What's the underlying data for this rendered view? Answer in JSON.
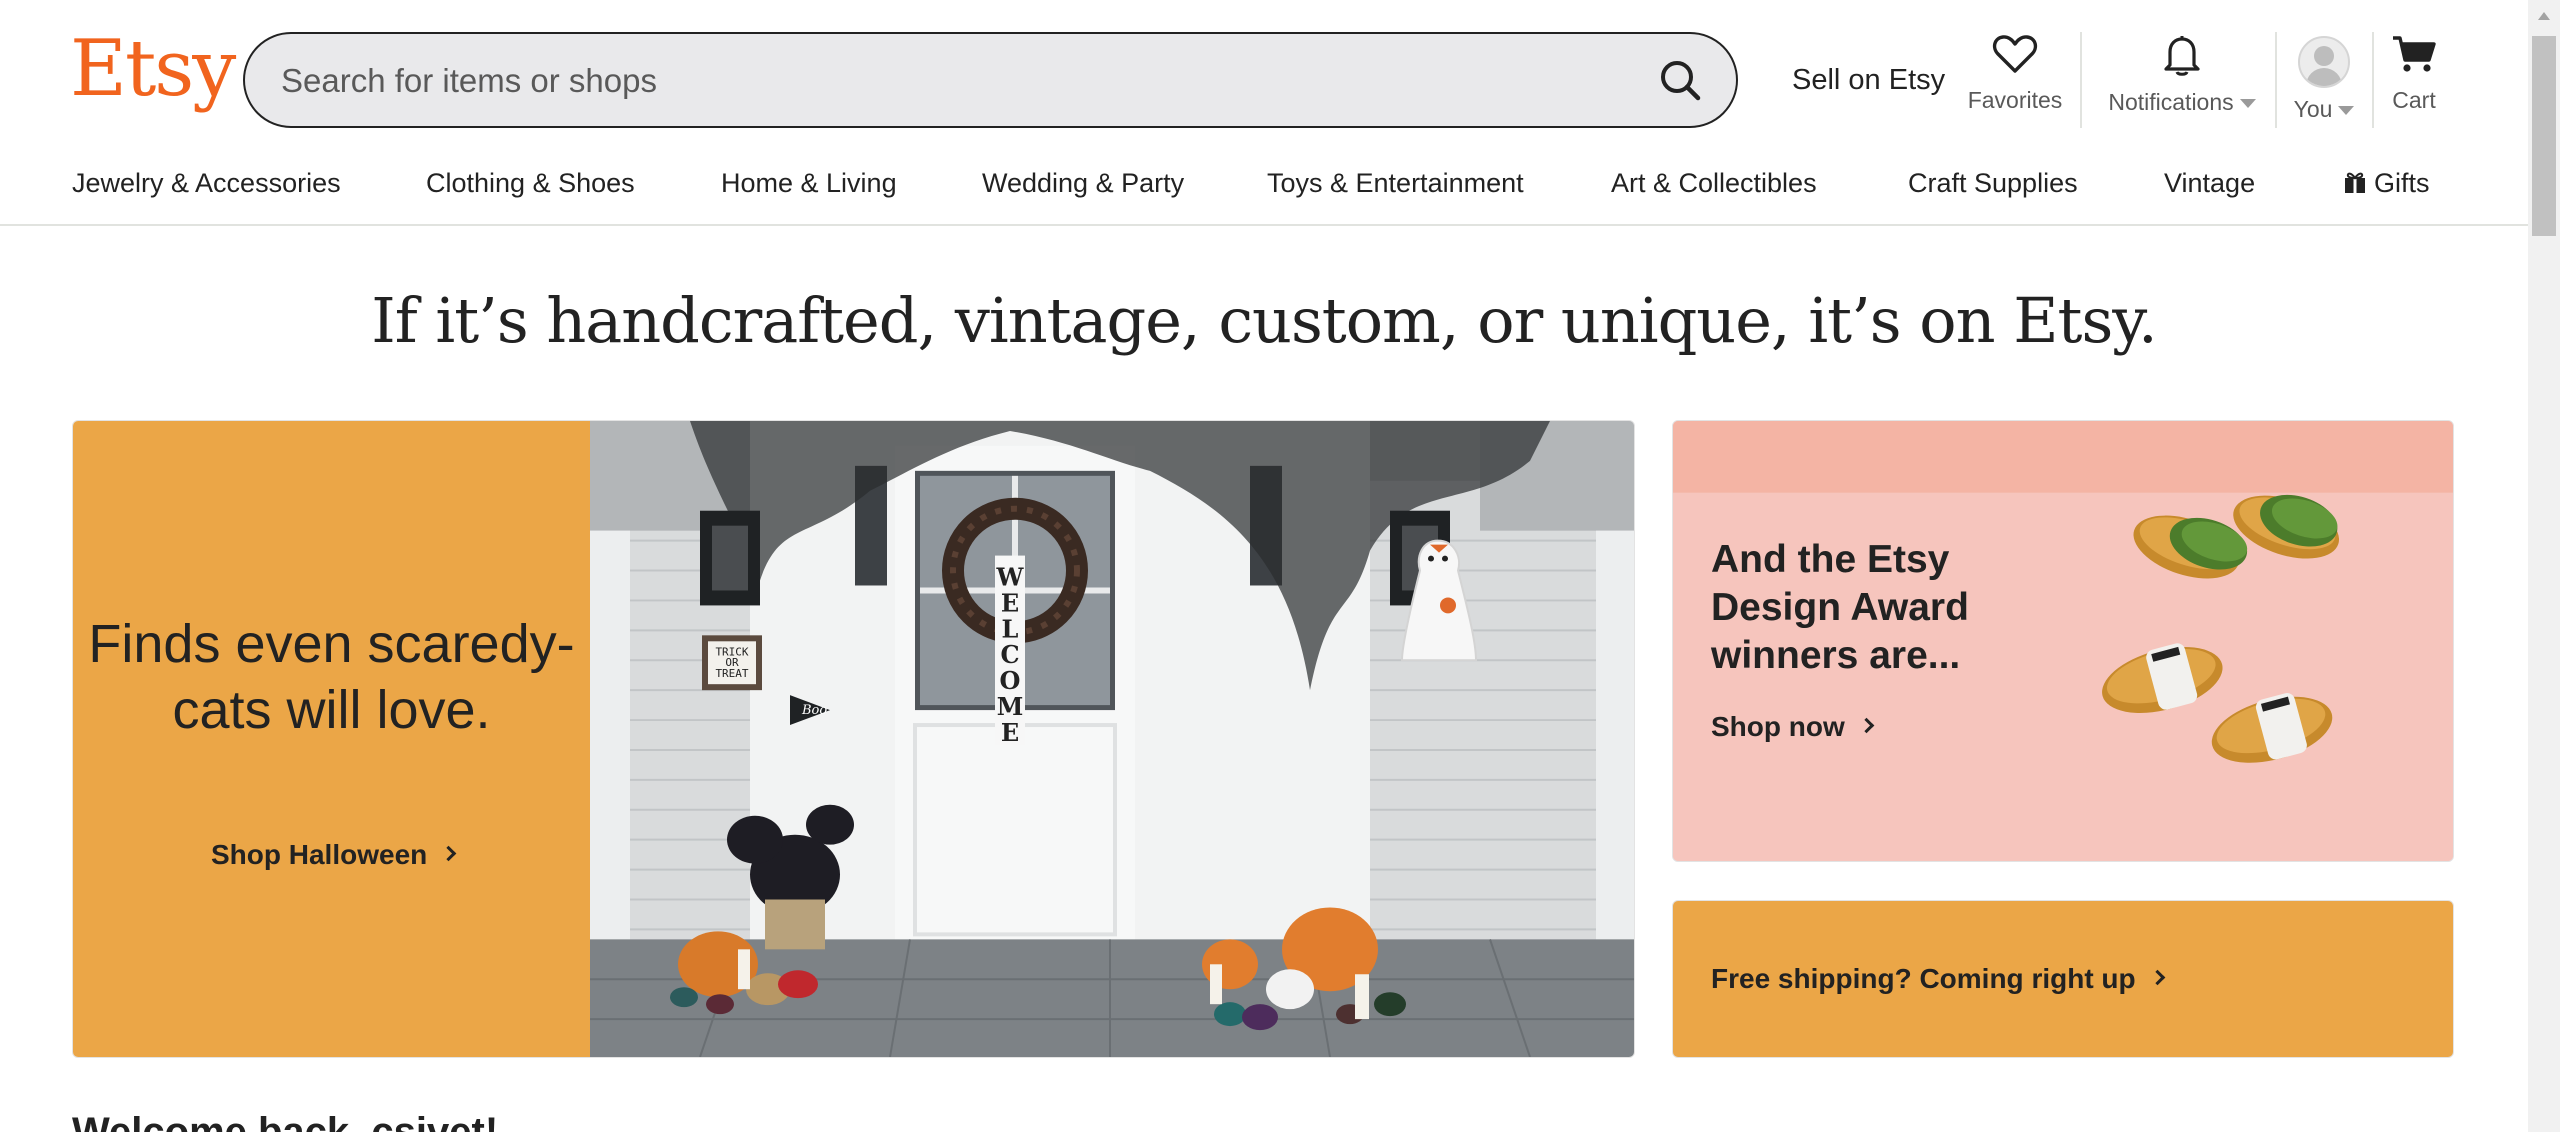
{
  "header": {
    "logo": "Etsy",
    "search": {
      "placeholder": "Search for items or shops"
    },
    "sell_label": "Sell on Etsy",
    "favorites_label": "Favorites",
    "notifications_label": "Notifications",
    "you_label": "You",
    "cart_label": "Cart"
  },
  "categories": [
    "Jewelry & Accessories",
    "Clothing & Shoes",
    "Home & Living",
    "Wedding & Party",
    "Toys & Entertainment",
    "Art & Collectibles",
    "Craft Supplies",
    "Vintage",
    "Gifts"
  ],
  "hero": {
    "tagline": "If it’s handcrafted, vintage, custom, or unique, it’s on Etsy.",
    "main_banner": {
      "heading": "Finds even scaredy-cats will love.",
      "cta": "Shop Halloween",
      "background_color": "#eba647",
      "photo_sign_text": "TRICK OR TREAT",
      "photo_pennant_text": "Boo",
      "photo_welcome_text": "WELCOME"
    },
    "side_banner": {
      "heading": "And the Etsy Design Award winners are...",
      "cta": "Shop now",
      "background_color": "#f7c7c0"
    },
    "shipping_banner": {
      "cta": "Free shipping? Coming right up",
      "background_color": "#eba647"
    }
  },
  "welcome_text": "Welcome back, csivet!",
  "colors": {
    "brand": "#f1641e",
    "text": "#222222",
    "muted": "#595959",
    "search_bg": "#e9e9eb"
  }
}
